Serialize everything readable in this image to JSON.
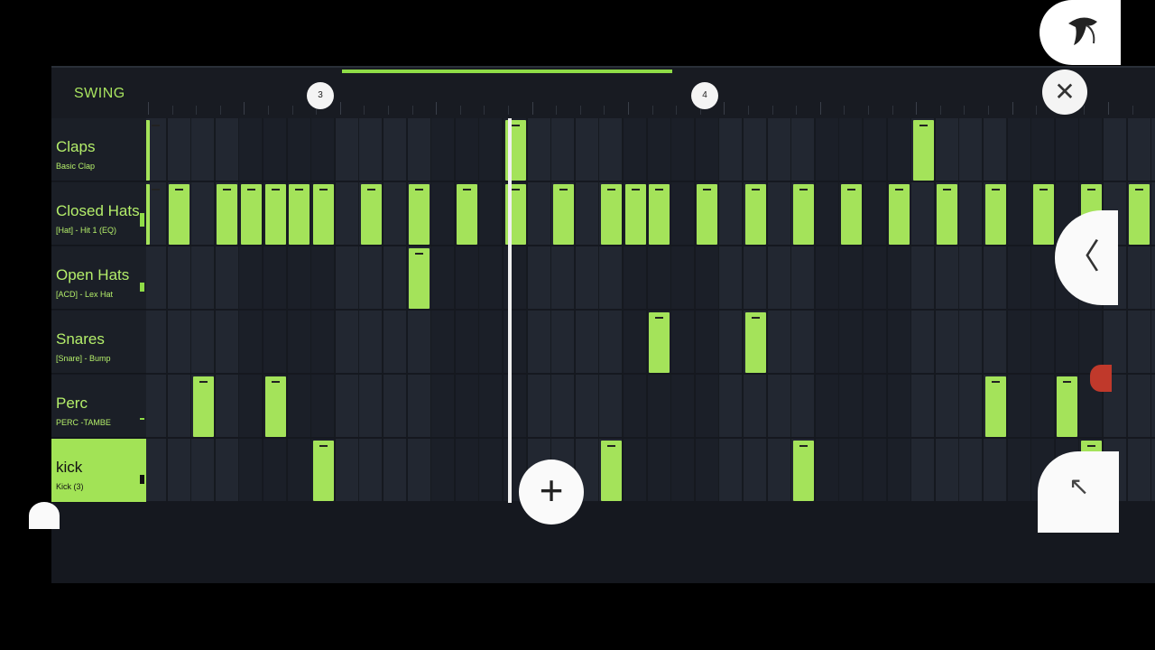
{
  "toolbar": {
    "swing_label": "SWING",
    "bar_markers": [
      "3",
      "4"
    ],
    "close_icon": "close-icon",
    "logo_icon": "fl-fruit-logo-icon"
  },
  "channels": [
    {
      "name": "Claps",
      "sample": "Basic Clap"
    },
    {
      "name": "Closed Hats",
      "sample": "[Hat] - Hit 1 (EQ)"
    },
    {
      "name": "Open Hats",
      "sample": "[ACD] - Lex Hat"
    },
    {
      "name": "Snares",
      "sample": "[Snare] - Bump"
    },
    {
      "name": "Perc",
      "sample": "PERC -TAMBE"
    },
    {
      "name": "kick",
      "sample": "Kick (3)"
    }
  ],
  "selected_channel": "kick",
  "colors": {
    "accent": "#a4e35a",
    "background": "#15181f"
  },
  "controls": {
    "add_icon": "plus-icon",
    "back_icon": "chevron-left-icon",
    "expand_icon": "arrow-up-left-icon"
  }
}
